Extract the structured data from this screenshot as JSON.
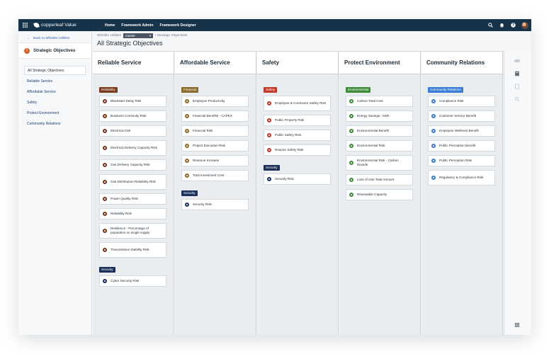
{
  "app": {
    "brand": "copperleaf Value",
    "nav": [
      "Home",
      "Framework Admin",
      "Framework Designer"
    ],
    "icons": [
      "grid-icon",
      "search-icon",
      "bell-icon",
      "help-icon",
      "avatar"
    ]
  },
  "sidebar": {
    "back_label": "Back to Whistler Utilities",
    "section_icon_letter": "!",
    "section_title": "Strategic Objectives",
    "items": [
      "All Strategic Objectives",
      "Reliable Service",
      "Affordable Service",
      "Safety",
      "Protect Environment",
      "Community Relations"
    ]
  },
  "header": {
    "crumb_root": "Whistler Utilities",
    "crumb_branch": "master",
    "crumb_tail": "/ Strategic Objectives",
    "title": "All Strategic Objectives"
  },
  "colors": {
    "topbar": "#17334a",
    "reliability": "#7a3a1c",
    "financial": "#8a6a2a",
    "safety": "#c0392b",
    "security": "#1b2f5a",
    "environmental": "#3f8a3a",
    "community": "#3a7bd5"
  },
  "columns": [
    {
      "title": "Reliable Service",
      "groups": [
        {
          "tag": "Reliability",
          "color": "#7a3a1c",
          "cards": [
            "Blackstart Delay Risk",
            "Business Continuity Risk",
            "Electrical CMI",
            "Electrical Delivery Capacity Risk",
            "Gas Delivery Capacity Risk",
            "Gas Distribution Reliability Risk",
            "Power Quality Risk",
            "Reliability Risk",
            "Resilience - Percentage of population on single supply",
            "Transmission Stability Risk"
          ]
        },
        {
          "tag": "Security",
          "color": "#1b2f5a",
          "cards": [
            "Cyber Security Risk"
          ]
        }
      ]
    },
    {
      "title": "Affordable Service",
      "groups": [
        {
          "tag": "Financial",
          "color": "#8a6a2a",
          "cards": [
            "Employee Productivity",
            "Financial Benefits - CAPEX",
            "Financial Risk",
            "Project Execution Risk",
            "Revenue Increase",
            "Total Investment Cost"
          ]
        },
        {
          "tag": "Security",
          "color": "#1b2f5a",
          "cards": [
            "Security Risk"
          ]
        }
      ]
    },
    {
      "title": "Safety",
      "groups": [
        {
          "tag": "Safety",
          "color": "#c0392b",
          "cards": [
            "Employee & Contractor Safety Risk",
            "Public Property Risk",
            "Public Safety Risk",
            "Reactor Safety Risk"
          ]
        },
        {
          "tag": "Security",
          "color": "#1b2f5a",
          "cards": [
            "Security Risk"
          ]
        }
      ]
    },
    {
      "title": "Protect Environment",
      "groups": [
        {
          "tag": "Environmental",
          "color": "#3f8a3a",
          "cards": [
            "Carbon Total Cost",
            "Energy Savings - kWh",
            "Environmental Benefit",
            "Environmental Risk",
            "Environmental Risk - Carbon Dioxide",
            "Loss of Gas Total Amount",
            "Renewable Capacity"
          ]
        }
      ]
    },
    {
      "title": "Community Relations",
      "groups": [
        {
          "tag": "Community Relations",
          "color": "#3a7bd5",
          "cards": [
            "Compliance Risk",
            "Customer Service Benefit",
            "Employee Wellness Benefit",
            "Public Perception Benefit",
            "Public Perception Risk",
            "Regulatory & Compliance Risk"
          ]
        }
      ]
    }
  ]
}
